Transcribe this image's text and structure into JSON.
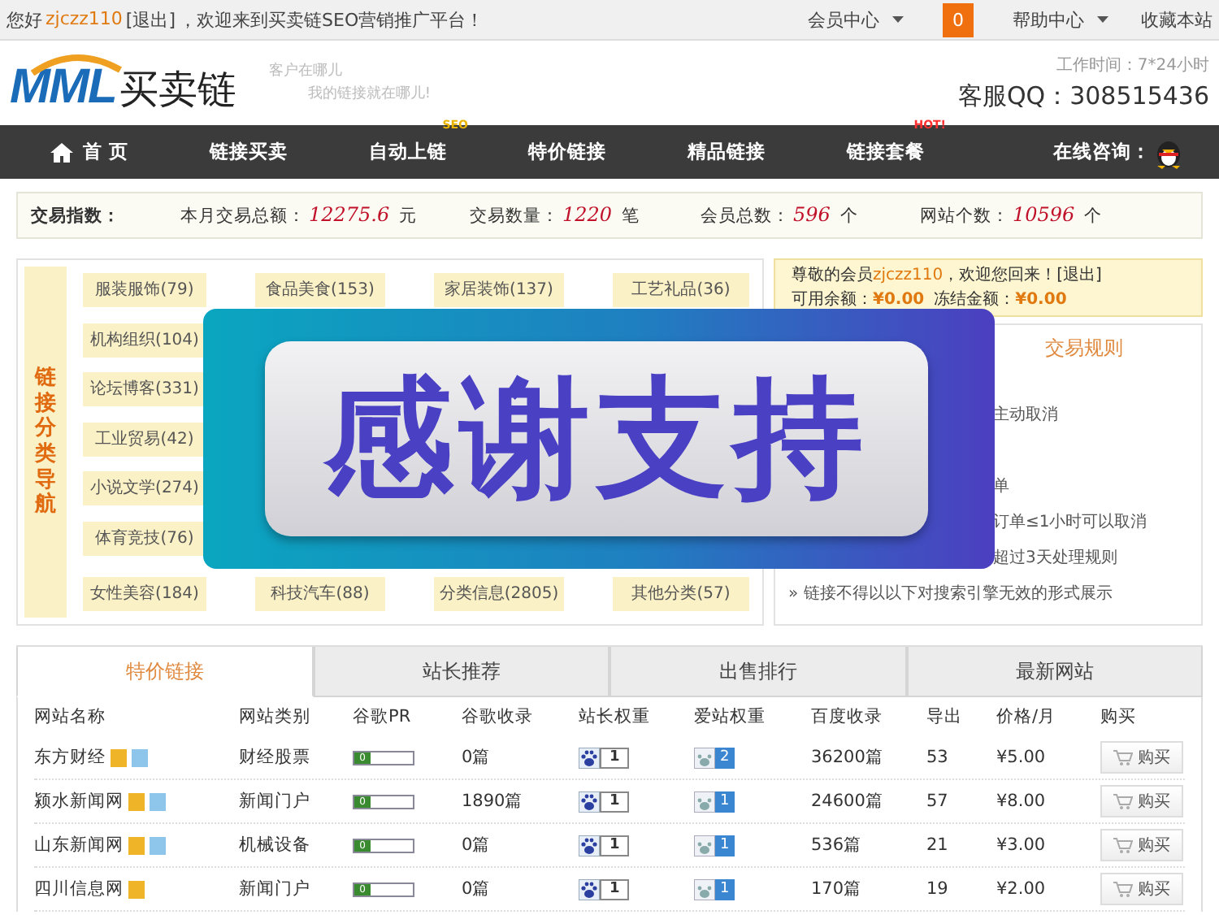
{
  "top_bar": {
    "greeting": "您好",
    "username": "zjczz110",
    "logout": "[退出]",
    "welcome": "，欢迎来到买卖链SEO营销推广平台！",
    "links": [
      {
        "label": "会员中心",
        "kind": "dropdown"
      },
      {
        "label": "0",
        "kind": "badge"
      },
      {
        "label": "帮助中心",
        "kind": "dropdown"
      },
      {
        "label": "收藏本站",
        "kind": "link"
      }
    ]
  },
  "header": {
    "logo_mark": "MML",
    "logo_text": "买卖链",
    "slogan": [
      "客户在哪儿",
      "我的链接就在哪儿!"
    ],
    "hours": "工作时间：7*24小时",
    "qq": "客服QQ：308515436"
  },
  "nav": {
    "items": [
      {
        "label": "首 页",
        "kind": "home"
      },
      {
        "label": "链接买卖",
        "kind": "link"
      },
      {
        "label": "自动上链",
        "kind": "link",
        "badge": {
          "text": "SEO",
          "color": "#e8b400"
        }
      },
      {
        "label": "特价链接",
        "kind": "link"
      },
      {
        "label": "精品链接",
        "kind": "link"
      },
      {
        "label": "链接套餐",
        "kind": "link",
        "badge": {
          "text": "HOT!",
          "color": "#ff3030"
        }
      }
    ],
    "consult": "在线咨询："
  },
  "stats": {
    "title": "交易指数：",
    "items": [
      {
        "label": "本月交易总额：",
        "value": "12275.6",
        "unit": "元"
      },
      {
        "label": "交易数量：",
        "value": "1220",
        "unit": "笔"
      },
      {
        "label": "会员总数：",
        "value": "596",
        "unit": "个"
      },
      {
        "label": "网站个数：",
        "value": "10596",
        "unit": "个"
      }
    ]
  },
  "categories": {
    "title": "链接分类导航",
    "rows": [
      [
        "服装服饰(79)",
        "食品美食(153)",
        "家居装饰(137)",
        "工艺礼品(36)"
      ],
      [
        "机构组织(104)"
      ],
      [
        "论坛博客(331)"
      ],
      [
        "工业贸易(42)"
      ],
      [
        "小说文学(274)"
      ],
      [
        "体育竞技(76)"
      ],
      [
        "女性美容(184)",
        "科技汽车(88)",
        "分类信息(2805)",
        "其他分类(57)"
      ]
    ]
  },
  "member": {
    "prefix": "尊敬的会员",
    "username": "zjczz110",
    "suffix": "，欢迎您回来！",
    "logout": "[退出]",
    "balance_label": "可用余额：",
    "balance": "¥0.00",
    "frozen_label": "冻结金额：",
    "frozen": "¥0.00"
  },
  "rules": {
    "title": "交易规则",
    "items": [
      {
        "text": "主动取消",
        "kind": "cut"
      },
      {
        "text": "单",
        "kind": "cut"
      },
      {
        "text": "订单≤1小时可以取消",
        "kind": "cut"
      },
      {
        "text": "超过3天处理规则",
        "kind": "cut"
      },
      {
        "text": "» 链接不得以以下对搜索引擎无效的形式展示",
        "kind": "full"
      }
    ]
  },
  "overlay": {
    "text": "感谢支持"
  },
  "tabs": [
    {
      "label": "特价链接",
      "selected": true
    },
    {
      "label": "站长推荐",
      "selected": false
    },
    {
      "label": "出售排行",
      "selected": false
    },
    {
      "label": "最新网站",
      "selected": false
    }
  ],
  "table": {
    "columns": [
      "网站名称",
      "网站类别",
      "谷歌PR",
      "谷歌收录",
      "站长权重",
      "爱站权重",
      "百度收录",
      "导出",
      "价格/月",
      "购买"
    ],
    "rows": [
      {
        "name": "东方财经",
        "tags": [
          {
            "color": "#f0b429"
          },
          {
            "color": "#8ec5ea"
          }
        ],
        "category": "财经股票",
        "pr": "0",
        "google_index": "0篇",
        "baidu_weight": "1",
        "aizhan_weight": "2",
        "baidu_index": "36200篇",
        "outbound": "53",
        "price": "¥5.00",
        "buy": "购买"
      },
      {
        "name": "颍水新闻网",
        "tags": [
          {
            "color": "#f0b429"
          },
          {
            "color": "#8ec5ea"
          }
        ],
        "category": "新闻门户",
        "pr": "0",
        "google_index": "1890篇",
        "baidu_weight": "1",
        "aizhan_weight": "1",
        "baidu_index": "24600篇",
        "outbound": "57",
        "price": "¥8.00",
        "buy": "购买"
      },
      {
        "name": "山东新闻网",
        "tags": [
          {
            "color": "#f0b429"
          },
          {
            "color": "#8ec5ea"
          }
        ],
        "category": "机械设备",
        "pr": "0",
        "google_index": "0篇",
        "baidu_weight": "1",
        "aizhan_weight": "1",
        "baidu_index": "536篇",
        "outbound": "21",
        "price": "¥3.00",
        "buy": "购买"
      },
      {
        "name": "四川信息网",
        "tags": [
          {
            "color": "#f0b429"
          }
        ],
        "category": "新闻门户",
        "pr": "0",
        "google_index": "0篇",
        "baidu_weight": "1",
        "aizhan_weight": "1",
        "baidu_index": "170篇",
        "outbound": "19",
        "price": "¥2.00",
        "buy": "购买"
      }
    ]
  }
}
